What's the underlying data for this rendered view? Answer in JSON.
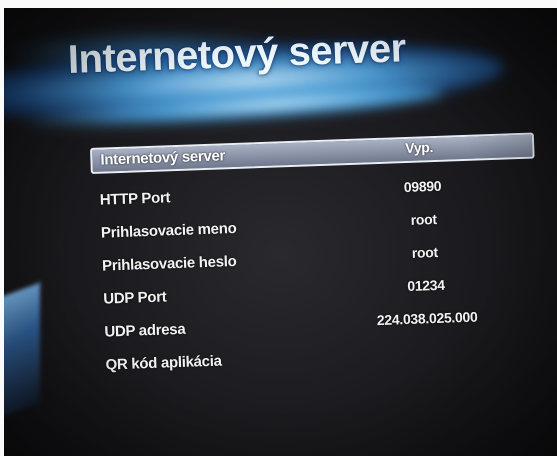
{
  "header": {
    "title": "Internetový server"
  },
  "menu": {
    "items": [
      {
        "label": "Internetový server",
        "value": "Vyp."
      },
      {
        "label": "HTTP Port",
        "value": "09890"
      },
      {
        "label": "Prihlasovacie meno",
        "value": "root"
      },
      {
        "label": "Prihlasovacie heslo",
        "value": "root"
      },
      {
        "label": "UDP Port",
        "value": "01234"
      },
      {
        "label": "UDP adresa",
        "value": "224.038.025.000"
      },
      {
        "label": "QR kód aplikácia",
        "value": ""
      }
    ],
    "selected_index": 0
  },
  "colors": {
    "screen_bg": "#1c1c20",
    "accent_blue": "#50aaeb",
    "highlight": "#8e97ab",
    "text": "#f2f2f2"
  }
}
